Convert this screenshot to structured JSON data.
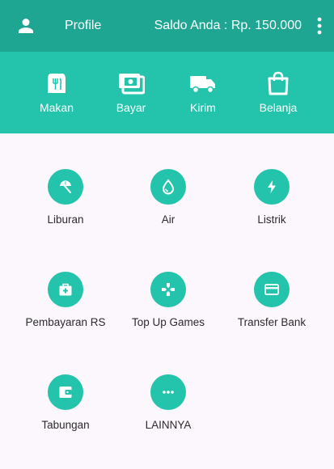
{
  "appbar": {
    "profile_label": "Profile",
    "balance_text": "Saldo Anda : Rp. 150.000",
    "profile_icon": "person-icon",
    "more_icon": "more-vert-icon"
  },
  "quick_actions": [
    {
      "label": "Makan",
      "icon": "restaurant-icon"
    },
    {
      "label": "Bayar",
      "icon": "payments-icon"
    },
    {
      "label": "Kirim",
      "icon": "truck-icon"
    },
    {
      "label": "Belanja",
      "icon": "shopping-bag-icon"
    }
  ],
  "services": [
    {
      "label": "Liburan",
      "icon": "beach-umbrella-icon"
    },
    {
      "label": "Air",
      "icon": "water-drop-icon"
    },
    {
      "label": "Listrik",
      "icon": "lightning-icon"
    },
    {
      "label": "Pembayaran RS",
      "icon": "medical-kit-icon"
    },
    {
      "label": "Top Up Games",
      "icon": "gamepad-icon"
    },
    {
      "label": "Transfer Bank",
      "icon": "credit-card-icon"
    },
    {
      "label": "Tabungan",
      "icon": "wallet-icon"
    },
    {
      "label": "LAINNYA",
      "icon": "more-horiz-icon"
    }
  ],
  "colors": {
    "appbar": "#1fa693",
    "quickbar": "#23c3ac",
    "accent": "#23c3ac",
    "background": "#fcf7fd"
  }
}
